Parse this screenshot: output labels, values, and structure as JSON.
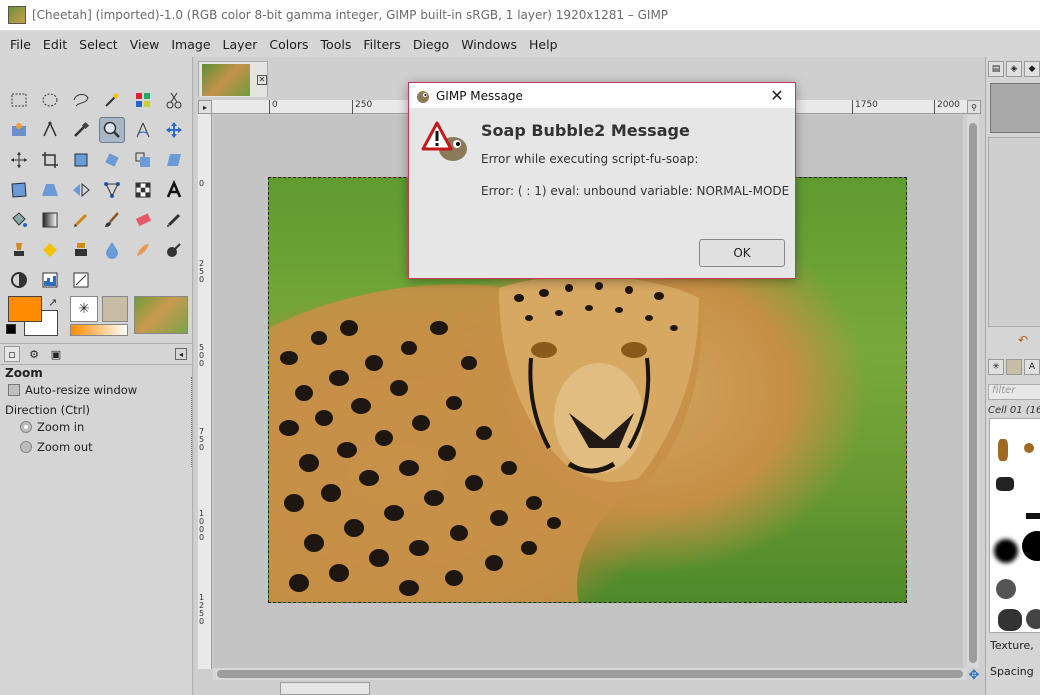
{
  "window": {
    "title": "[Cheetah] (imported)-1.0 (RGB color 8-bit gamma integer, GIMP built-in sRGB, 1 layer) 1920x1281 – GIMP"
  },
  "menubar": {
    "items": [
      "File",
      "Edit",
      "Select",
      "View",
      "Image",
      "Layer",
      "Colors",
      "Tools",
      "Filters",
      "Diego",
      "Windows",
      "Help"
    ]
  },
  "tool_options": {
    "title": "Zoom",
    "auto_resize_label": "Auto-resize window",
    "direction_label": "Direction  (Ctrl)",
    "zoom_in_label": "Zoom in",
    "zoom_out_label": "Zoom out",
    "selected_direction": "Zoom in"
  },
  "rulers": {
    "h_ticks": [
      "0",
      "250",
      "1750",
      "2000"
    ],
    "v_ticks": [
      "0",
      "250",
      "500",
      "750",
      "1000",
      "1250"
    ]
  },
  "right_dock": {
    "filter_placeholder": "filter",
    "brush_name": "Cell 01 (16",
    "texture_label": "Texture,",
    "spacing_label": "Spacing"
  },
  "dialog": {
    "title": "GIMP Message",
    "heading": "Soap Bubble2 Message",
    "line1": "Error while executing script-fu-soap:",
    "line2": "Error: ( : 1) eval: unbound variable: NORMAL-MODE",
    "ok_label": "OK"
  },
  "colors": {
    "foreground": "#ff8c00",
    "background": "#ffffff",
    "dialog_border": "#c33b5a"
  }
}
